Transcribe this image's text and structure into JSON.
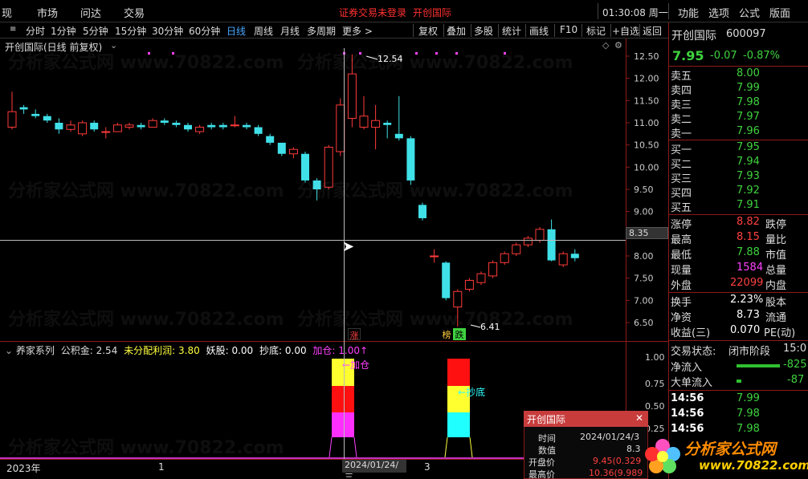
{
  "topbar": {
    "items": [
      "现",
      "市场",
      "问达",
      "交易"
    ],
    "notice_login": "证券交易未登录",
    "notice_stock": "开创国际",
    "clock": "01:30:08 周一",
    "right_items": [
      "功能",
      "选项",
      "公式",
      "版面"
    ]
  },
  "periodbar": {
    "periods": [
      "分时",
      "1分钟",
      "5分钟",
      "15分钟",
      "30分钟",
      "60分钟",
      "日线",
      "周线",
      "月线",
      "多周期",
      "更多 >"
    ],
    "active": "日线",
    "tools": [
      "复权",
      "叠加",
      "多股",
      "统计",
      "画线",
      "F10",
      "标记",
      "+自选",
      "返回"
    ]
  },
  "chart": {
    "title": "开创国际(日线 前复权)",
    "y_ticks": [
      "12.50",
      "12.00",
      "11.50",
      "11.00",
      "10.50",
      "10.00",
      "9.50",
      "9.00",
      "8.50",
      "8.00",
      "7.50",
      "7.00",
      "6.50"
    ],
    "crosshair_price": "8.35",
    "high_label": "12.54",
    "low_label": "6.41",
    "tag_up": "涨",
    "tag_bang": "榜",
    "tag_down": "跌",
    "watermark": "分析家公式网 www.70822.com"
  },
  "chart_data": {
    "type": "candlestick",
    "title": "开创国际(日线 前复权)",
    "ylim": [
      6.2,
      12.8
    ],
    "candles": [
      {
        "o": 10.9,
        "c": 11.25,
        "h": 11.7,
        "l": 10.85
      },
      {
        "o": 11.35,
        "c": 11.3,
        "h": 11.4,
        "l": 11.2
      },
      {
        "o": 11.2,
        "c": 11.15,
        "h": 11.3,
        "l": 11.1
      },
      {
        "o": 11.15,
        "c": 11.05,
        "h": 11.2,
        "l": 11.0
      },
      {
        "o": 11.0,
        "c": 10.85,
        "h": 11.1,
        "l": 10.75
      },
      {
        "o": 10.85,
        "c": 10.95,
        "h": 11.05,
        "l": 10.8
      },
      {
        "o": 10.75,
        "c": 11.0,
        "h": 11.05,
        "l": 10.7
      },
      {
        "o": 11.0,
        "c": 10.85,
        "h": 11.05,
        "l": 10.8
      },
      {
        "o": 10.8,
        "c": 10.8,
        "h": 10.9,
        "l": 10.65
      },
      {
        "o": 10.8,
        "c": 10.95,
        "h": 11.0,
        "l": 10.8
      },
      {
        "o": 10.9,
        "c": 10.95,
        "h": 11.0,
        "l": 10.85
      },
      {
        "o": 10.95,
        "c": 10.9,
        "h": 11.0,
        "l": 10.85
      },
      {
        "o": 10.9,
        "c": 11.05,
        "h": 11.1,
        "l": 10.9
      },
      {
        "o": 11.05,
        "c": 11.0,
        "h": 11.1,
        "l": 10.95
      },
      {
        "o": 11.0,
        "c": 10.95,
        "h": 11.05,
        "l": 10.9
      },
      {
        "o": 10.95,
        "c": 10.85,
        "h": 11.0,
        "l": 10.8
      },
      {
        "o": 10.8,
        "c": 10.9,
        "h": 10.95,
        "l": 10.75
      },
      {
        "o": 10.95,
        "c": 10.9,
        "h": 11.0,
        "l": 10.85
      },
      {
        "o": 10.95,
        "c": 10.9,
        "h": 11.0,
        "l": 10.85
      },
      {
        "o": 10.95,
        "c": 10.95,
        "h": 11.15,
        "l": 10.9
      },
      {
        "o": 10.95,
        "c": 10.9,
        "h": 11.0,
        "l": 10.85
      },
      {
        "o": 10.9,
        "c": 10.75,
        "h": 10.95,
        "l": 10.7
      },
      {
        "o": 10.7,
        "c": 10.55,
        "h": 10.75,
        "l": 10.5
      },
      {
        "o": 10.55,
        "c": 10.3,
        "h": 10.55,
        "l": 10.25
      },
      {
        "o": 10.3,
        "c": 10.4,
        "h": 10.45,
        "l": 10.2
      },
      {
        "o": 10.3,
        "c": 9.7,
        "h": 10.35,
        "l": 9.65
      },
      {
        "o": 9.7,
        "c": 9.5,
        "h": 9.75,
        "l": 9.25
      },
      {
        "o": 9.55,
        "c": 10.45,
        "h": 10.5,
        "l": 9.5
      },
      {
        "o": 10.35,
        "c": 11.4,
        "h": 11.55,
        "l": 10.25
      },
      {
        "o": 11.1,
        "c": 12.1,
        "h": 12.54,
        "l": 10.9
      },
      {
        "o": 10.9,
        "c": 11.15,
        "h": 11.6,
        "l": 10.85
      },
      {
        "o": 10.9,
        "c": 11.05,
        "h": 11.4,
        "l": 10.4
      },
      {
        "o": 11.0,
        "c": 10.95,
        "h": 11.05,
        "l": 10.65
      },
      {
        "o": 10.75,
        "c": 10.65,
        "h": 11.6,
        "l": 10.6
      },
      {
        "o": 10.65,
        "c": 9.7,
        "h": 10.7,
        "l": 9.6
      },
      {
        "o": 9.15,
        "c": 8.85,
        "h": 9.2,
        "l": 8.8
      },
      {
        "o": 8.0,
        "c": 8.0,
        "h": 8.15,
        "l": 7.85
      },
      {
        "o": 7.85,
        "c": 7.05,
        "h": 7.88,
        "l": 7.0
      },
      {
        "o": 6.85,
        "c": 7.2,
        "h": 7.25,
        "l": 6.41
      },
      {
        "o": 7.25,
        "c": 7.45,
        "h": 7.5,
        "l": 7.2
      },
      {
        "o": 7.4,
        "c": 7.6,
        "h": 7.65,
        "l": 7.35
      },
      {
        "o": 7.55,
        "c": 7.85,
        "h": 7.9,
        "l": 7.5
      },
      {
        "o": 7.85,
        "c": 8.05,
        "h": 8.1,
        "l": 7.8
      },
      {
        "o": 8.05,
        "c": 8.25,
        "h": 8.3,
        "l": 8.0
      },
      {
        "o": 8.25,
        "c": 8.4,
        "h": 8.45,
        "l": 8.2
      },
      {
        "o": 8.35,
        "c": 8.6,
        "h": 8.65,
        "l": 8.3
      },
      {
        "o": 8.6,
        "c": 7.9,
        "h": 8.82,
        "l": 7.88
      },
      {
        "o": 7.8,
        "c": 8.05,
        "h": 8.1,
        "l": 7.75
      },
      {
        "o": 8.05,
        "c": 7.95,
        "h": 8.15,
        "l": 7.88
      }
    ]
  },
  "indicator": {
    "name": "养家系列",
    "gjj_label": "公积金:",
    "gjj_value": "2.54",
    "wfp_label": "未分配利润:",
    "wfp_value": "3.80",
    "yg_label": "妖股:",
    "yg_value": "0.00",
    "cd_label": "抄底:",
    "cd_value": "0.00",
    "jc_label": "加仓:",
    "jc_value": "1.00",
    "y_ticks": [
      "1.00",
      "0.75",
      "0.50",
      "0.25"
    ],
    "label_jiacang": "加仓",
    "label_chaodi": "抄底"
  },
  "xaxis": {
    "year": "2023年",
    "mark1": "1",
    "date": "2024/01/24/三",
    "mark2": "3"
  },
  "quote": {
    "name": "开创国际",
    "code": "600097",
    "price": "7.95",
    "change": "-0.07",
    "pct": "-0.87%",
    "asks": [
      {
        "label": "卖五",
        "price": "8.00"
      },
      {
        "label": "卖四",
        "price": "7.99"
      },
      {
        "label": "卖三",
        "price": "7.98"
      },
      {
        "label": "卖二",
        "price": "7.97"
      },
      {
        "label": "卖一",
        "price": "7.96"
      }
    ],
    "bids": [
      {
        "label": "买一",
        "price": "7.95"
      },
      {
        "label": "买二",
        "price": "7.94"
      },
      {
        "label": "买三",
        "price": "7.93"
      },
      {
        "label": "买四",
        "price": "7.92"
      },
      {
        "label": "买五",
        "price": "7.91"
      }
    ],
    "stats": [
      {
        "label": "涨停",
        "value": "8.82",
        "right": "跌停"
      },
      {
        "label": "最高",
        "value": "8.15",
        "right": "量比"
      },
      {
        "label": "最低",
        "value": "7.88",
        "right": "市值"
      },
      {
        "label": "现量",
        "value": "1584",
        "right": "总量"
      },
      {
        "label": "外盘",
        "value": "22099",
        "right": "内盘"
      }
    ],
    "stats2": [
      {
        "label": "换手",
        "value": "2.23%",
        "right": "股本"
      },
      {
        "label": "净资",
        "value": "8.73",
        "right": "流通"
      },
      {
        "label": "收益(三)",
        "value": "0.070",
        "right": "PE(动)"
      }
    ],
    "status_label": "交易状态:",
    "status_value": "闭市阶段",
    "status_time": "15:0",
    "net_inflow_label": "净流入",
    "net_inflow_value": "-825",
    "big_inflow_label": "大单流入",
    "big_inflow_value": "-87",
    "ticks": [
      {
        "time": "14:56",
        "price": "7.99"
      },
      {
        "time": "14:56",
        "price": "7.98"
      },
      {
        "time": "14:56",
        "price": "7.98"
      }
    ]
  },
  "tooltip": {
    "title": "开创国际",
    "rows": [
      {
        "label": "时间",
        "value": "2024/01/24/3"
      },
      {
        "label": "数值",
        "value": "8.3"
      },
      {
        "label": "开盘价",
        "value": "9.45(0.329"
      },
      {
        "label": "最高价",
        "value": "10.36(9.989"
      }
    ]
  },
  "logo": {
    "title": "分析家公式网",
    "url": "www.70822.com"
  }
}
